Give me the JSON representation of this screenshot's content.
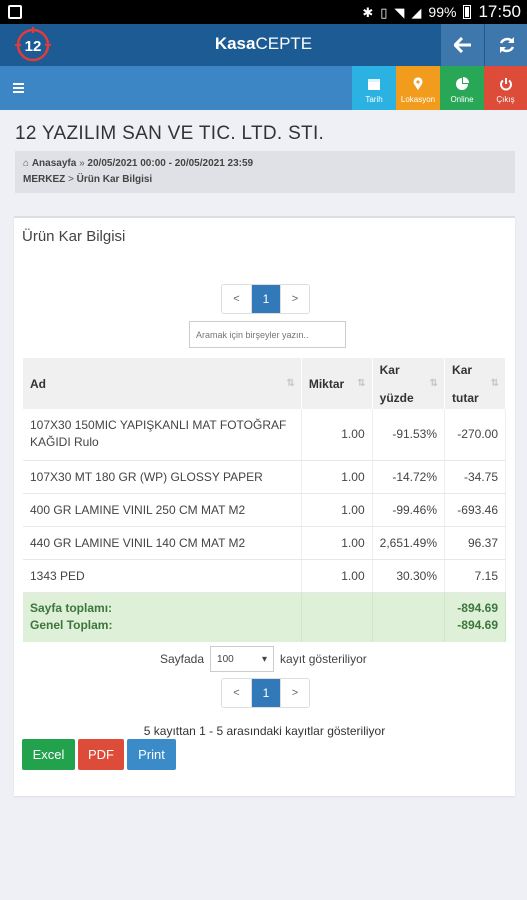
{
  "status": {
    "battery": "99%",
    "time": "17:50"
  },
  "header": {
    "title_bold": "Kasa",
    "title_rest": "CEPTE"
  },
  "nav": {
    "tiles": [
      {
        "label": "Tarih"
      },
      {
        "label": "Lokasyon"
      },
      {
        "label": "Online"
      },
      {
        "label": "Çıkış"
      }
    ]
  },
  "company": "12 YAZILIM SAN VE TIC. LTD. STI.",
  "breadcrumb": {
    "home": "Anasayfa",
    "sep": "»",
    "range": "20/05/2021 00:00 - 20/05/2021 23:59",
    "location": "MERKEZ",
    "arrow": ">",
    "page": "Ürün Kar Bilgisi"
  },
  "panel": {
    "title": "Ürün Kar Bilgisi",
    "search_placeholder": "Aramak için birşeyler yazın..",
    "pager": {
      "prev": "<",
      "current": "1",
      "next": ">"
    },
    "columns": {
      "ad": "Ad",
      "miktar": "Miktar",
      "kar_yuzde_1": "Kar",
      "kar_yuzde_2": "yüzde",
      "kar_tutar_1": "Kar",
      "kar_tutar_2": "tutar"
    },
    "rows": [
      {
        "ad1": "107X30 150MIC YAPIŞKANLI MAT FOTOĞRAF",
        "ad2": "KAĞIDI Rulo",
        "miktar": "1.00",
        "yuzde": "-91.53%",
        "tutar": "-270.00"
      },
      {
        "ad1": "107X30 MT 180 GR (WP) GLOSSY PAPER",
        "miktar": "1.00",
        "yuzde": "-14.72%",
        "tutar": "-34.75"
      },
      {
        "ad1": "400 GR LAMINE VINIL 250 CM MAT M2",
        "miktar": "1.00",
        "yuzde": "-99.46%",
        "tutar": "-693.46"
      },
      {
        "ad1": "440 GR LAMINE VINIL 140 CM MAT M2",
        "miktar": "1.00",
        "yuzde": "2,651.49%",
        "tutar": "96.37"
      },
      {
        "ad1": "1343 PED",
        "miktar": "1.00",
        "yuzde": "30.30%",
        "tutar": "7.15"
      }
    ],
    "totals": {
      "sayfa_label": "Sayfa toplamı:",
      "genel_label": "Genel Toplam:",
      "sayfa_value": "-894.69",
      "genel_value": "-894.69"
    },
    "pagesize": {
      "prefix": "Sayfada",
      "value": "100",
      "suffix": "kayıt gösteriliyor"
    },
    "info": "5 kayıttan 1 - 5 arasındaki kayıtlar gösteriliyor",
    "buttons": {
      "excel": "Excel",
      "pdf": "PDF",
      "print": "Print"
    }
  }
}
